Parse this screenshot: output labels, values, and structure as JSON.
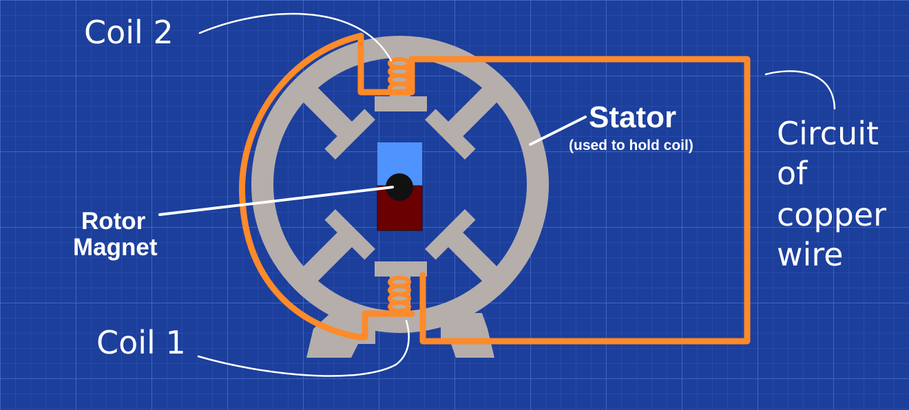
{
  "labels": {
    "coil2": "Coil 2",
    "coil1": "Coil 1",
    "stator": "Stator",
    "stator_note": "(used to hold coil)",
    "rotor_line1": "Rotor",
    "rotor_line2": "Magnet",
    "circuit_line1": "Circuit",
    "circuit_line2": "of",
    "circuit_line3": "copper",
    "circuit_line4": "wire"
  },
  "colors": {
    "background": "#1c3f9c",
    "grid": "#3a63c4",
    "stator": "#b5aeab",
    "wire": "#ff8a2a",
    "magnet_north": "#4f93ff",
    "magnet_south": "#6b0000",
    "annotation": "#ffffff"
  }
}
